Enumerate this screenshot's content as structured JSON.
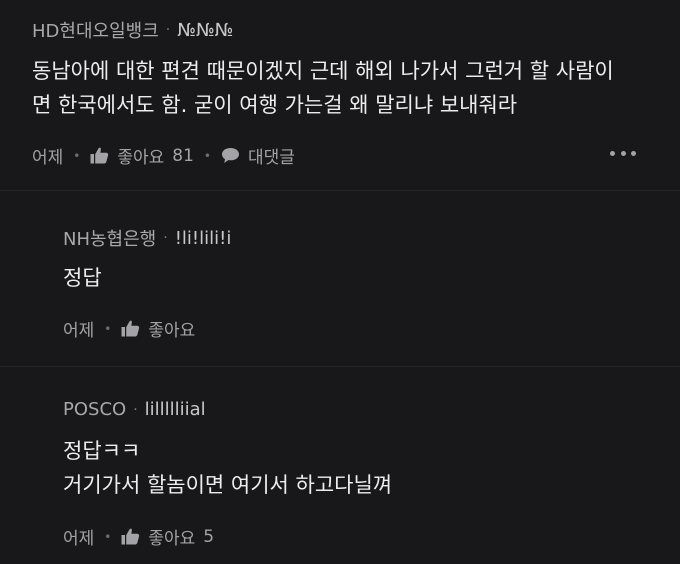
{
  "top_comment": {
    "company": "HD현대오일뱅크",
    "nickname": "№№№",
    "lines": [
      "동남아에 대한 편견 때문이겠지 근데 해외 나가서 그런거 할 사람이",
      "면 한국에서도 함. 굳이 여행 가는걸 왜 말리냐 보내줘라"
    ],
    "time": "어제",
    "like_label": "좋아요",
    "like_count": "81",
    "reply_label": "대댓글"
  },
  "replies": [
    {
      "company": "NH농협은행",
      "nickname": "!li!lili!i",
      "lines": [
        "정답"
      ],
      "time": "어제",
      "like_label": "좋아요",
      "like_count": ""
    },
    {
      "company": "POSCO",
      "nickname": "lillllliial",
      "lines": [
        "정답ㅋㅋ",
        "거기가서 할놈이면 여기서 하고다닐껴"
      ],
      "time": "어제",
      "like_label": "좋아요",
      "like_count": "5"
    }
  ],
  "icons": {
    "like": "thumbs-up-icon",
    "reply": "speech-bubble-icon",
    "more": "more-dots-icon"
  },
  "colors": {
    "background": "#111113",
    "card": "#18181a",
    "text": "#ededee",
    "muted": "#a3a3a7"
  }
}
